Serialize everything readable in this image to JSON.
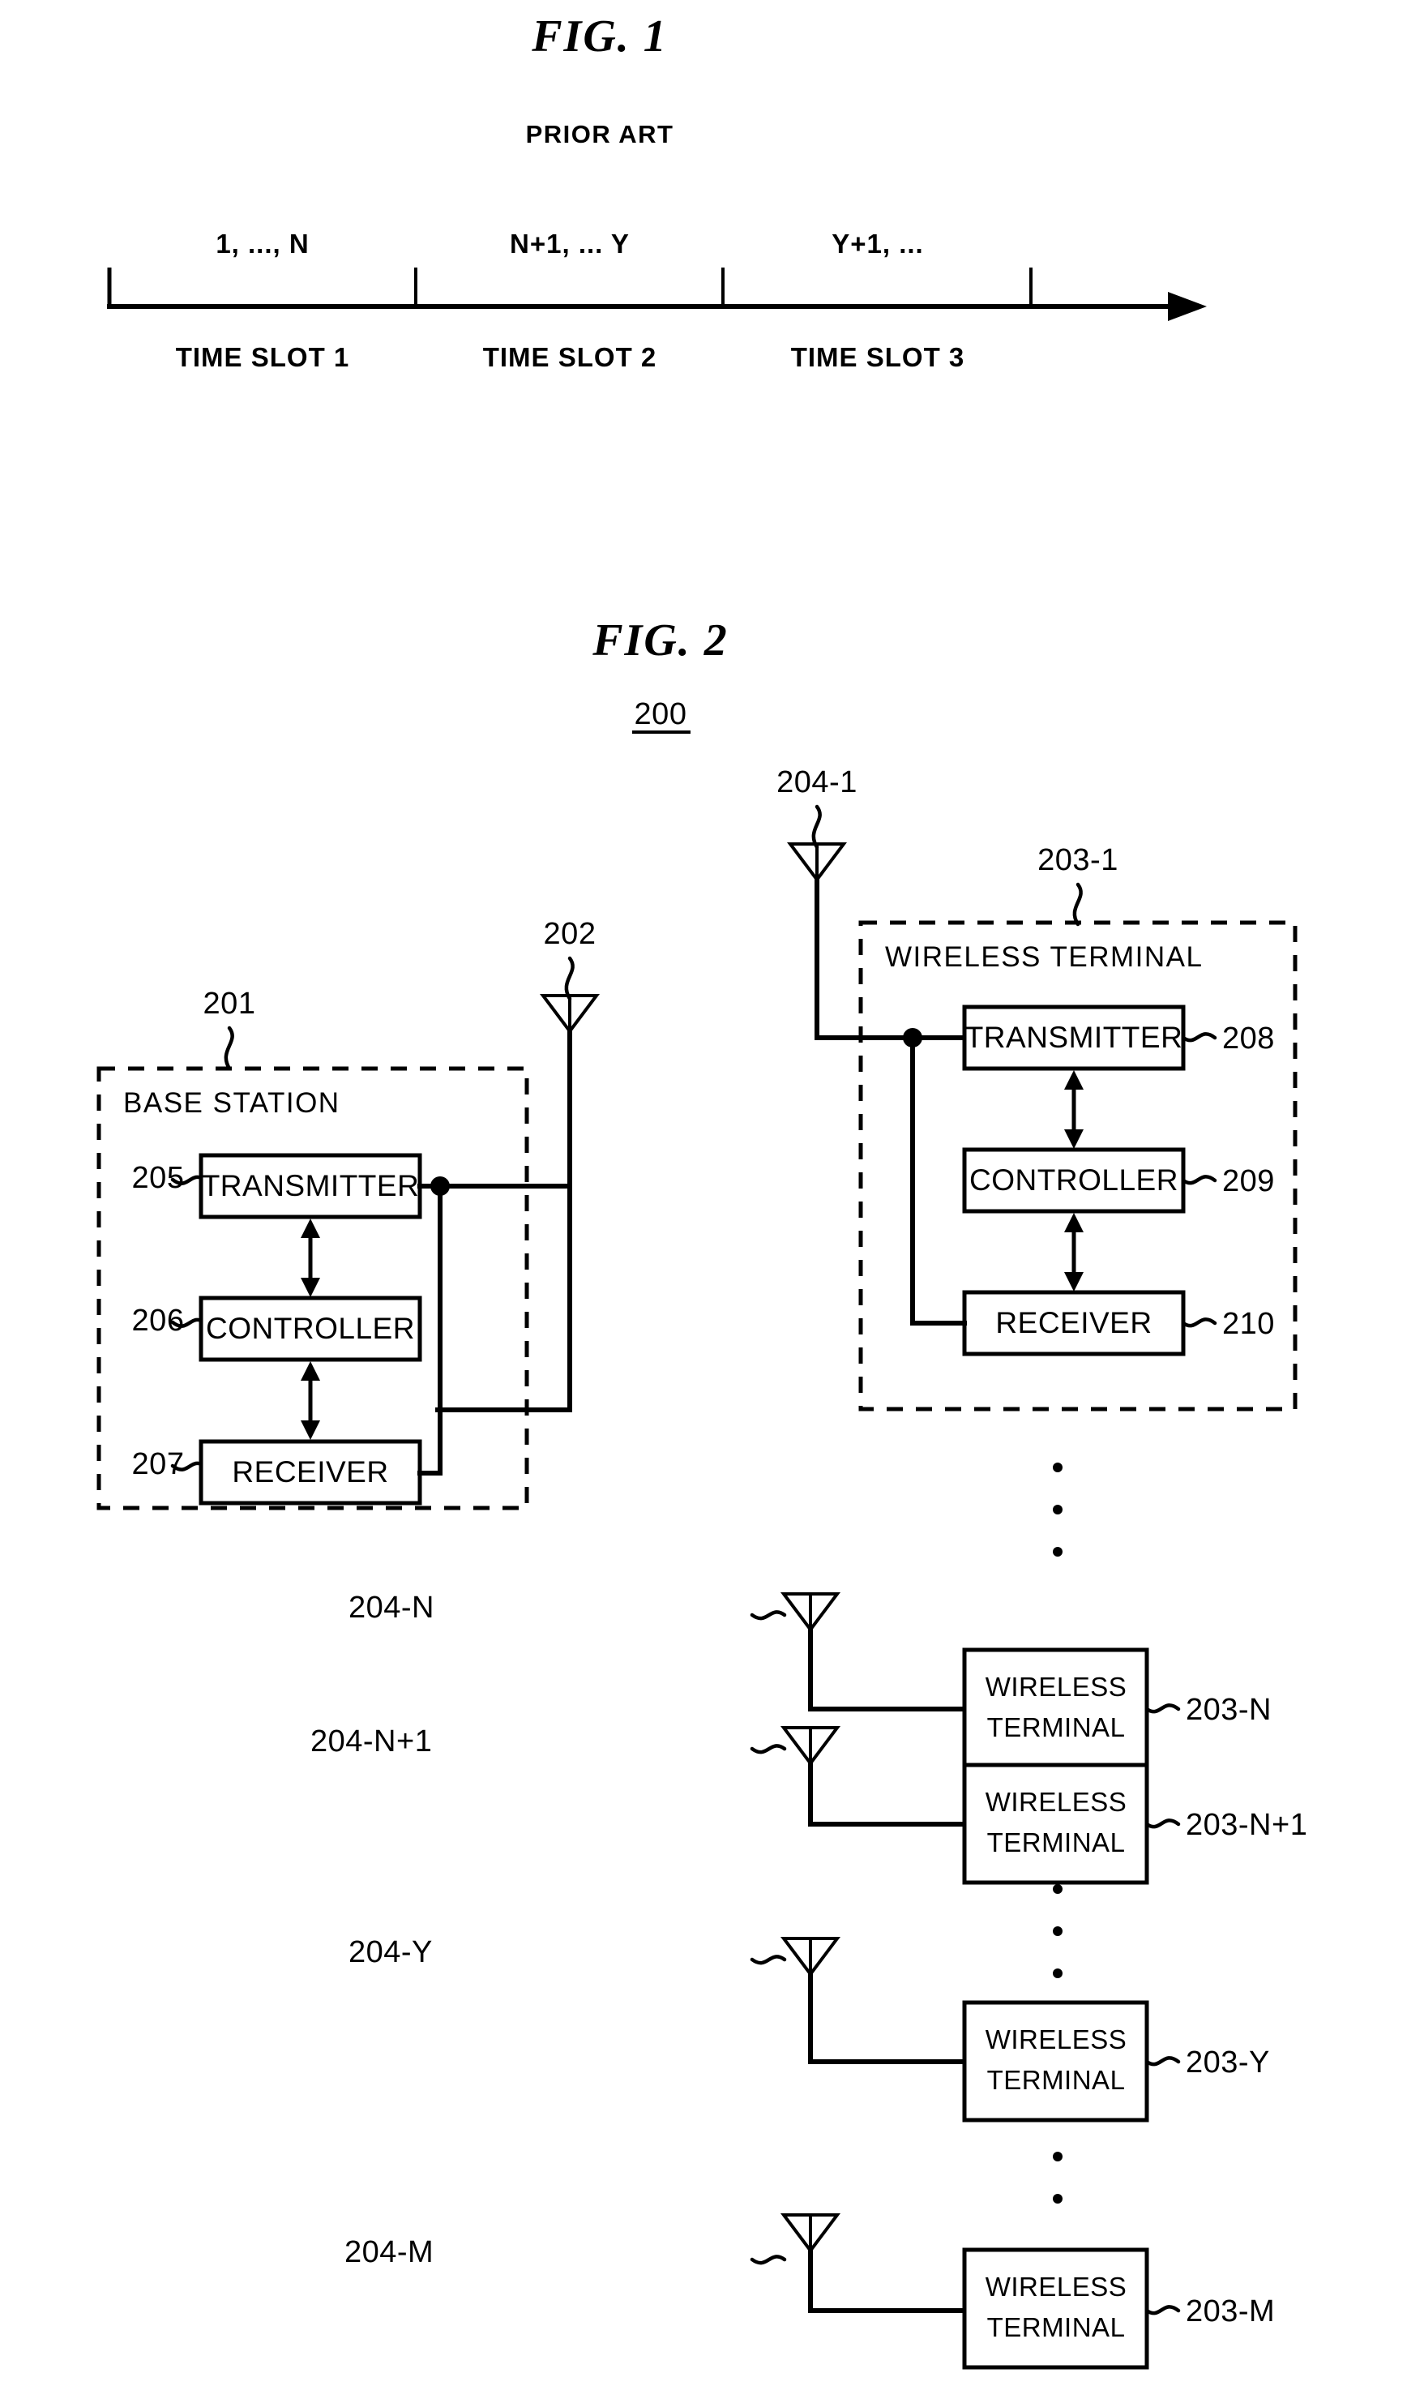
{
  "figure1": {
    "title": "FIG.  1",
    "subtitle": "PRIOR ART",
    "slot_ranges": [
      "1, ..., N",
      "N+1, ... Y",
      "Y+1, ..."
    ],
    "slot_labels": [
      "TIME SLOT 1",
      "TIME SLOT 2",
      "TIME SLOT 3"
    ]
  },
  "figure2": {
    "title": "FIG.  2",
    "system_ref": "200",
    "base_station": {
      "ref": "201",
      "label": "BASE STATION",
      "antenna_ref": "202",
      "blocks": [
        {
          "ref": "205",
          "label": "TRANSMITTER"
        },
        {
          "ref": "206",
          "label": "CONTROLLER"
        },
        {
          "ref": "207",
          "label": "RECEIVER"
        }
      ]
    },
    "terminal_detail": {
      "ref": "203-1",
      "label": "WIRELESS TERMINAL",
      "antenna_ref": "204-1",
      "blocks": [
        {
          "ref": "208",
          "label": "TRANSMITTER"
        },
        {
          "ref": "209",
          "label": "CONTROLLER"
        },
        {
          "ref": "210",
          "label": "RECEIVER"
        }
      ]
    },
    "terminals": [
      {
        "antenna_ref": "204-N",
        "ref": "203-N",
        "line1": "WIRELESS",
        "line2": "TERMINAL"
      },
      {
        "antenna_ref": "204-N+1",
        "ref": "203-N+1",
        "line1": "WIRELESS",
        "line2": "TERMINAL"
      },
      {
        "antenna_ref": "204-Y",
        "ref": "203-Y",
        "line1": "WIRELESS",
        "line2": "TERMINAL"
      },
      {
        "antenna_ref": "204-M",
        "ref": "203-M",
        "line1": "WIRELESS",
        "line2": "TERMINAL"
      }
    ]
  },
  "colors": {
    "ink": "#000000",
    "paper": "#ffffff"
  }
}
